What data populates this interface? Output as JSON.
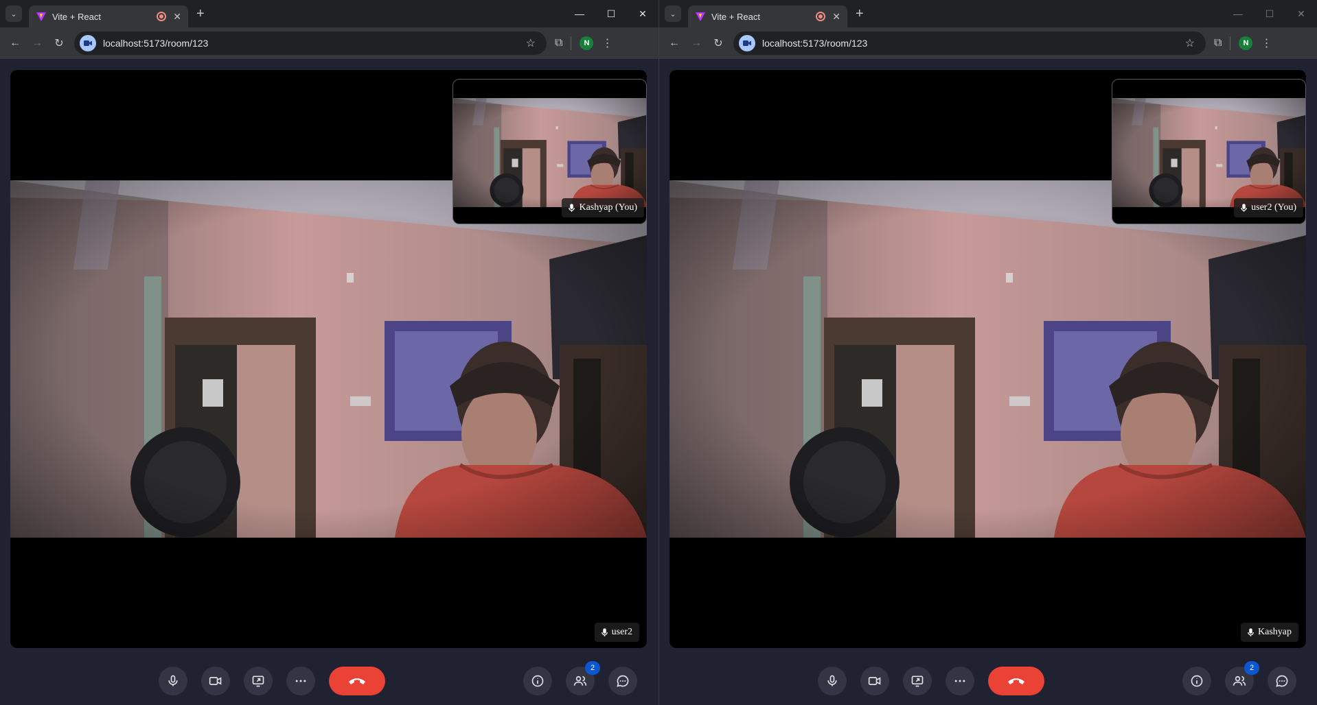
{
  "windows": [
    {
      "tab_title": "Vite + React",
      "url": "localhost:5173/room/123",
      "profile_initial": "N",
      "remote_name": "user2",
      "self_name": "Kashyap (You)",
      "participant_count": "2",
      "window_controls_active": true
    },
    {
      "tab_title": "Vite + React",
      "url": "localhost:5173/room/123",
      "profile_initial": "N",
      "remote_name": "Kashyap",
      "self_name": "user2 (You)",
      "participant_count": "2",
      "window_controls_active": false
    }
  ],
  "colors": {
    "end_call": "#ea4335",
    "badge": "#0b57d0",
    "control_bg": "#333544",
    "page_bg": "#202232"
  },
  "icons": {
    "mic": "mic-icon",
    "camera": "camera-icon",
    "share": "screen-share-icon",
    "more": "more-icon",
    "end": "phone-hangup-icon",
    "info": "info-icon",
    "people": "people-icon",
    "chat": "chat-icon"
  }
}
